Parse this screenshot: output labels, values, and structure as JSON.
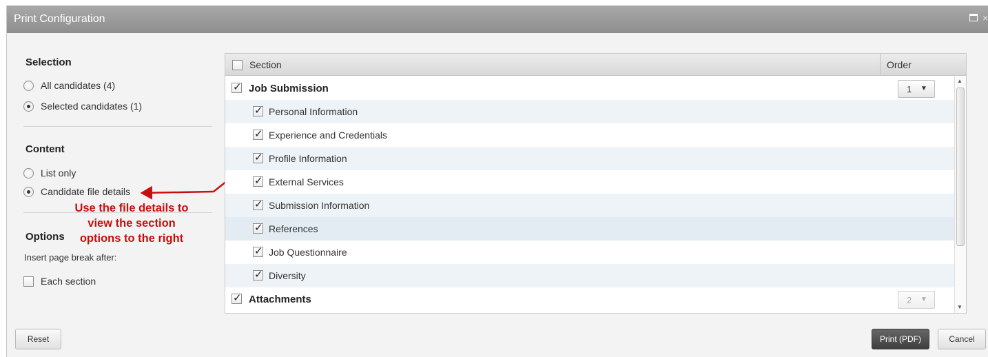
{
  "dialog": {
    "title": "Print Configuration"
  },
  "selection": {
    "heading": "Selection",
    "options": [
      {
        "label": "All candidates (4)",
        "selected": false
      },
      {
        "label": "Selected candidates (1)",
        "selected": true
      }
    ]
  },
  "content": {
    "heading": "Content",
    "options": [
      {
        "label": "List only",
        "selected": false
      },
      {
        "label": "Candidate file details",
        "selected": true
      }
    ]
  },
  "annotation": {
    "text": "Use the file details to view the section options to the right",
    "color": "#c80f0f"
  },
  "options": {
    "heading": "Options",
    "pagebreak_label": "Insert page break after:",
    "each_section_label": "Each section",
    "each_section_checked": false
  },
  "table": {
    "header_section": "Section",
    "header_order": "Order",
    "rows": [
      {
        "label": "Job Submission",
        "level": "parent",
        "checked": true,
        "order": "1"
      },
      {
        "label": "Personal Information",
        "level": "child",
        "checked": true
      },
      {
        "label": "Experience and Credentials",
        "level": "child",
        "checked": true
      },
      {
        "label": "Profile Information",
        "level": "child",
        "checked": true
      },
      {
        "label": "External Services",
        "level": "child",
        "checked": true
      },
      {
        "label": "Submission Information",
        "level": "child",
        "checked": true
      },
      {
        "label": "References",
        "level": "child",
        "checked": true
      },
      {
        "label": "Job Questionnaire",
        "level": "child",
        "checked": true
      },
      {
        "label": "Diversity",
        "level": "child",
        "checked": true
      },
      {
        "label": "Attachments",
        "level": "parent",
        "checked": true,
        "order": "2"
      }
    ]
  },
  "footer": {
    "reset_label": "Reset",
    "print_label": "Print (PDF)",
    "cancel_label": "Cancel"
  }
}
